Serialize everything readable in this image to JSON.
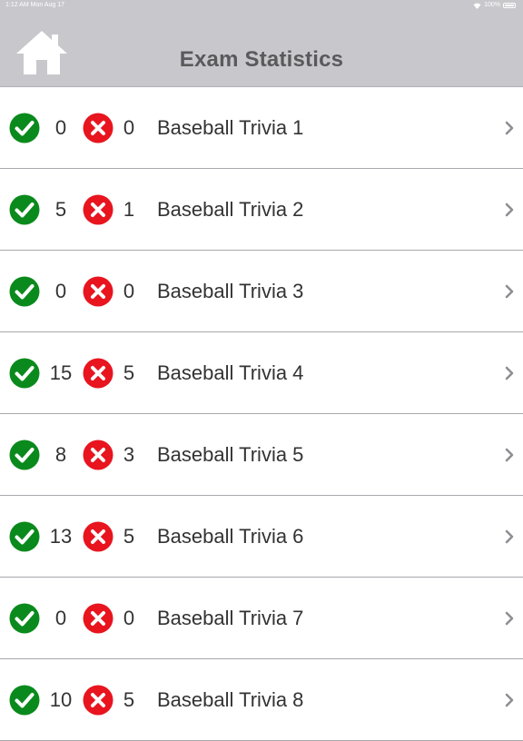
{
  "status_bar": {
    "time_date": "1:12 AM  Mon Aug 17",
    "battery": "100%"
  },
  "header": {
    "title": "Exam Statistics",
    "home_icon": "home-icon"
  },
  "colors": {
    "correct": "#0a8a1c",
    "wrong": "#e8141e",
    "navbar": "#c8c7cc",
    "chevron": "#8e8e93"
  },
  "exams": [
    {
      "correct": "0",
      "wrong": "0",
      "name": "Baseball Trivia 1"
    },
    {
      "correct": "5",
      "wrong": "1",
      "name": "Baseball Trivia 2"
    },
    {
      "correct": "0",
      "wrong": "0",
      "name": "Baseball Trivia 3"
    },
    {
      "correct": "15",
      "wrong": "5",
      "name": "Baseball Trivia 4"
    },
    {
      "correct": "8",
      "wrong": "3",
      "name": "Baseball Trivia 5"
    },
    {
      "correct": "13",
      "wrong": "5",
      "name": "Baseball Trivia 6"
    },
    {
      "correct": "0",
      "wrong": "0",
      "name": "Baseball Trivia 7"
    },
    {
      "correct": "10",
      "wrong": "5",
      "name": "Baseball Trivia 8"
    }
  ]
}
